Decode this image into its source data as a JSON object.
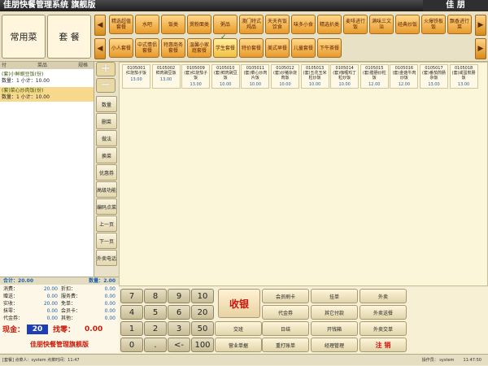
{
  "title": "佳朋快餐管理系统  旗舰版",
  "title_right": "佳 朋",
  "top_tabs": [
    "常用菜",
    "套 餐"
  ],
  "categories_row1": [
    "精选超值套餐",
    "水吧",
    "饭类",
    "煲粉面类",
    "粥品",
    "澳门特式炖品",
    "天天有饭饮食",
    "味多小食",
    "精选扒类",
    "麦啡进行饭",
    "满味三文治",
    "经典炒饭",
    "火爆铁板饭",
    "飘香进行菜"
  ],
  "categories_row2": [
    "小人套餐",
    "中式情侣套餐",
    "特惠商务套餐",
    "温馨小家庭套餐",
    "学生套餐",
    "特价套餐",
    "美式早餐",
    "儿童套餐",
    "下午茶餐"
  ],
  "selected_category": "学生套餐",
  "order_panel": {
    "headers": [
      "付",
      "菜品",
      "规格"
    ],
    "items": [
      {
        "name": "(套)小鲜豌豆饭(份)",
        "detail": "数量：1    小计：10.00"
      },
      {
        "name": "(套)菜心炒肉饭(份)",
        "detail": "数量：1    小计：10.00"
      }
    ]
  },
  "side_buttons": [
    "数量",
    "删菜",
    "做法",
    "换菜",
    "优惠券",
    "高级功能",
    "编码点菜",
    "上一页",
    "下一页",
    "外卖电话"
  ],
  "dishes": [
    {
      "code": "0105001",
      "name": "红烧茄子饭",
      "price": "13.00"
    },
    {
      "code": "0105002",
      "name": "鲜肉豌豆饭",
      "price": "13.00"
    },
    {
      "code": "0105009",
      "name": "(套)红烧茄子饭",
      "price": "13.00"
    },
    {
      "code": "0105010",
      "name": "(套)鲜肉豌豆饭",
      "price": "10.00"
    },
    {
      "code": "0105011",
      "name": "(套)菜心炒肉片饭",
      "price": "10.00"
    },
    {
      "code": "0105012",
      "name": "(套)炒猪杂烧肉饭",
      "price": "10.00"
    },
    {
      "code": "0105013",
      "name": "(套)五花玉米粒炒饭",
      "price": "10.00"
    },
    {
      "code": "0105014",
      "name": "(套)咖喱鸡丁粒炒饭",
      "price": "10.00"
    },
    {
      "code": "0105015",
      "name": "(套)腊肠炒粒饭",
      "price": "12.00"
    },
    {
      "code": "0105016",
      "name": "(套)金菇牛肉炒饭",
      "price": "12.00"
    },
    {
      "code": "0105017",
      "name": "(套)番茄煎肠杂饭",
      "price": "13.00"
    },
    {
      "code": "0105018",
      "name": "(套)咸蛋煎肠饭",
      "price": "13.00"
    }
  ],
  "summary": {
    "total_label": "合计：",
    "total": "20.00",
    "qty_label": "数量：",
    "qty": "2.00",
    "rows": [
      [
        "消费：",
        "20.00",
        "折扣：",
        "0.00"
      ],
      [
        "赠送：",
        "0.00",
        "服务费：",
        "0.00"
      ],
      [
        "实收：",
        "20.00",
        "免单：",
        "0.00"
      ],
      [
        "抹零：",
        "0.00",
        "会员卡：",
        "0.00"
      ],
      [
        "代金券：",
        "0.00",
        "其他：",
        "0.00"
      ]
    ],
    "cash_label": "现金：",
    "cash_value": "20",
    "change_label": "找零：",
    "change_value": "0.00"
  },
  "brand": "佳朋快餐管理旗舰版",
  "keypad": {
    "keys": [
      "7",
      "8",
      "9",
      "10",
      "4",
      "5",
      "6",
      "20",
      "1",
      "2",
      "3",
      "50",
      "0",
      ".",
      "<-",
      "100"
    ],
    "cash_button": "收银",
    "functions": [
      "会员刷卡",
      "挂单",
      "外卖",
      "代金券",
      "其它付款",
      "外卖送餐",
      "交班",
      "日结",
      "开钱箱",
      "外卖交单",
      "营业单据",
      "重打账单",
      "经理管理",
      "注 销"
    ]
  },
  "status": {
    "left": "[套餐] 点菜人：system  点菜时间：11:47",
    "operator": "操作员： system",
    "time": "11:47:50"
  }
}
